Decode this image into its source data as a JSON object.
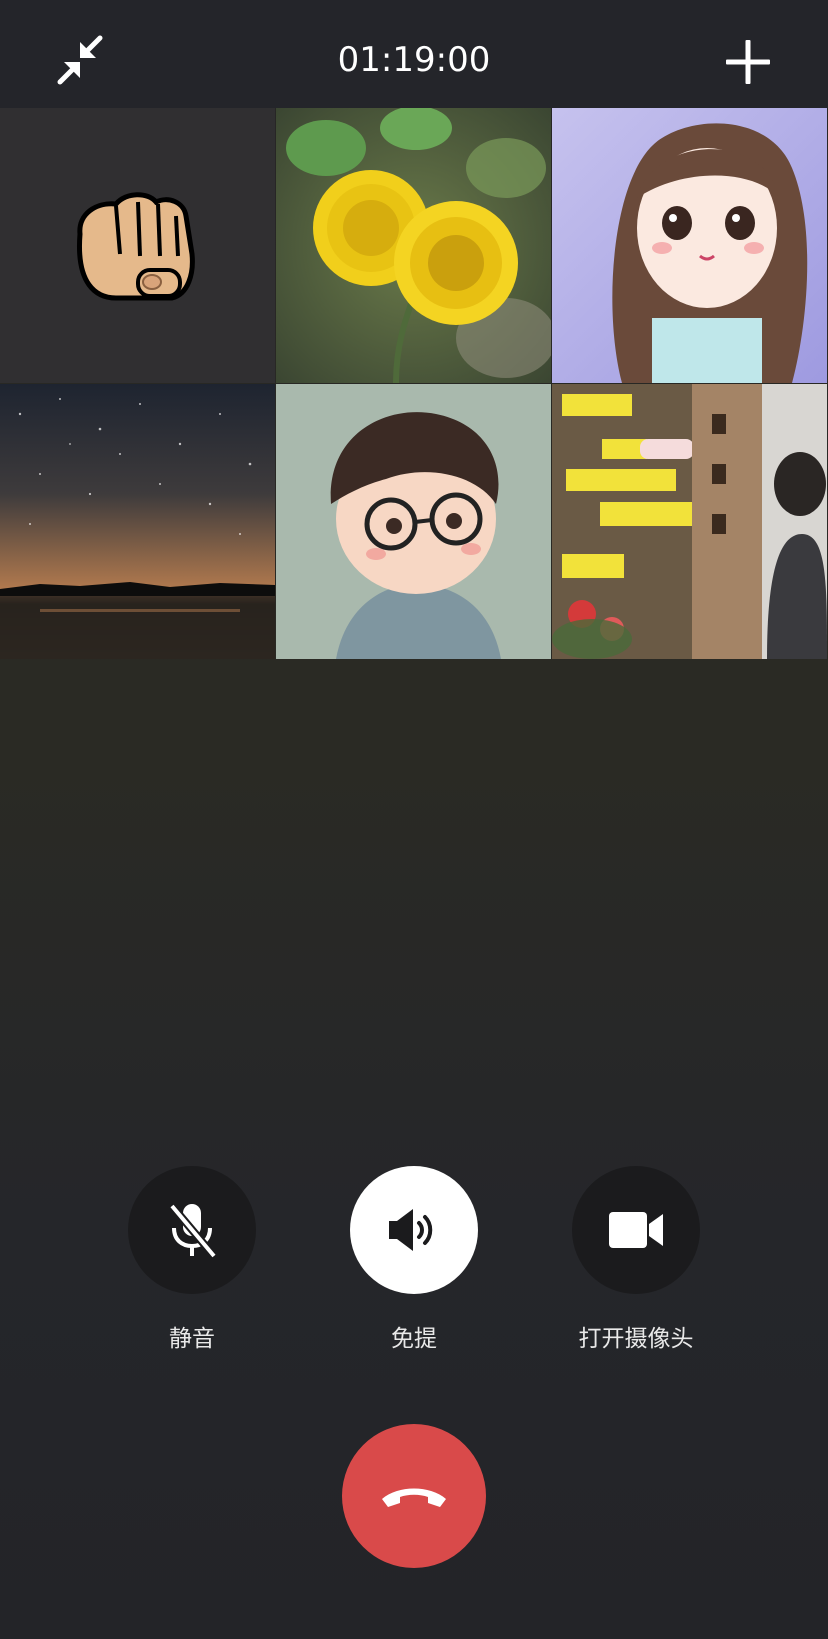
{
  "header": {
    "timer": "01:19:00",
    "minimize_icon": "minimize-arrows-icon",
    "add_icon": "plus-icon"
  },
  "participants": [
    {
      "name": "participant-fist",
      "icon": "fist-emoji-icon"
    },
    {
      "name": "participant-dandelion",
      "icon": "dandelion-photo"
    },
    {
      "name": "participant-anime-girl",
      "icon": "anime-girl-avatar"
    },
    {
      "name": "participant-night-sky",
      "icon": "night-sky-photo"
    },
    {
      "name": "participant-cartoon-boy",
      "icon": "cartoon-boy-avatar"
    },
    {
      "name": "participant-street-woman",
      "icon": "street-photo"
    }
  ],
  "controls": {
    "mute": {
      "label": "静音",
      "icon": "mic-off-icon"
    },
    "speaker": {
      "label": "免提",
      "icon": "speaker-icon",
      "active": true
    },
    "camera": {
      "label": "打开摄像头",
      "icon": "video-camera-icon"
    },
    "hangup": {
      "icon": "hang-up-phone-icon",
      "color": "#d94a4a"
    }
  },
  "colors": {
    "background": "#262626",
    "header": "#24252a",
    "control_dark": "#1b1b1d",
    "hangup": "#d94a4a"
  }
}
